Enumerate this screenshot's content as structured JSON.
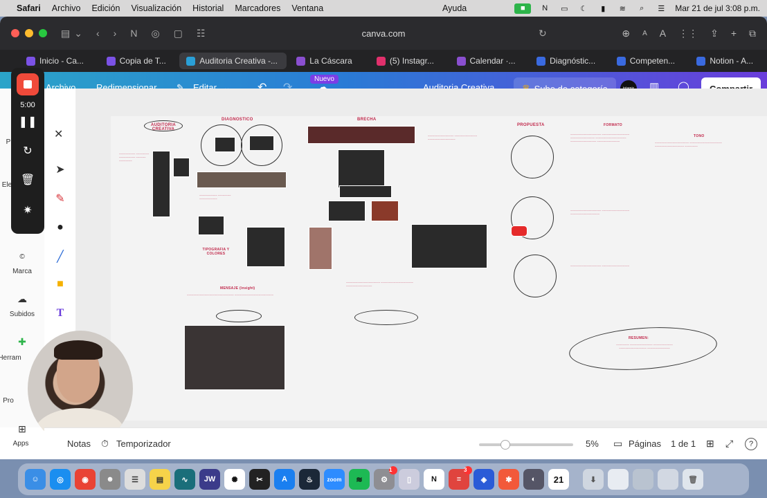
{
  "menubar": {
    "app": "Safari",
    "items": [
      "Archivo",
      "Edición",
      "Visualización",
      "Historial",
      "Marcadores",
      "Ventana"
    ],
    "help": "Ayuda",
    "clock": "Mar 21 de jul  3:08 p.m."
  },
  "browser": {
    "url": "canva.com",
    "tabs": [
      {
        "label": "Inicio - Ca...",
        "color": "#7b52e6"
      },
      {
        "label": "Copia de T...",
        "color": "#7b52e6"
      },
      {
        "label": "Auditoria Creativa -...",
        "color": "#2a9fd6",
        "active": true
      },
      {
        "label": "La Cáscara",
        "color": "#8a4fd0"
      },
      {
        "label": "(5) Instagr...",
        "color": "#e1306c"
      },
      {
        "label": "Calendar ·...",
        "color": "#8a4fd0"
      },
      {
        "label": "Diagnóstic...",
        "color": "#3a6ae0"
      },
      {
        "label": "Competen...",
        "color": "#3a6ae0"
      },
      {
        "label": "Notion - A...",
        "color": "#3a6ae0"
      }
    ]
  },
  "canva": {
    "archivo": "Archivo",
    "redimensionar": "Redimensionar",
    "editar": "Editar",
    "nuevo_badge": "Nuevo",
    "doc_title": "Auditoria Creativa",
    "upgrade": "Sube de categoría",
    "share": "Compartir",
    "avatar_text": "totamix"
  },
  "recorder": {
    "time": "5:00"
  },
  "rail": {
    "items": [
      "Marca",
      "Subidos",
      "Herram",
      "Pro",
      "Apps"
    ]
  },
  "rail_partial": {
    "p": "P",
    "el": "Ele"
  },
  "bottom": {
    "notas": "Notas",
    "timer": "Temporizador",
    "zoom": "5%",
    "pages_label": "Páginas",
    "pages_count": "1 de 1",
    "help": "?",
    "zoom_fraction": 0.25
  },
  "board": {
    "auditoria": "AUDITORIA CREATIVA",
    "diagnostico": "DIAGNOSTICO",
    "brecha": "BRECHA",
    "propuesta": "PROPUESTA",
    "formato": "FORMATO",
    "tono": "TONO",
    "tipografia": "TIPOGRAFIA Y COLORES",
    "mensaje": "MENSAJE (insight)",
    "resumen": "RESUMEN:"
  },
  "dock": {
    "calendar_day": "21",
    "badge_3": "3",
    "badge_1": "1"
  }
}
